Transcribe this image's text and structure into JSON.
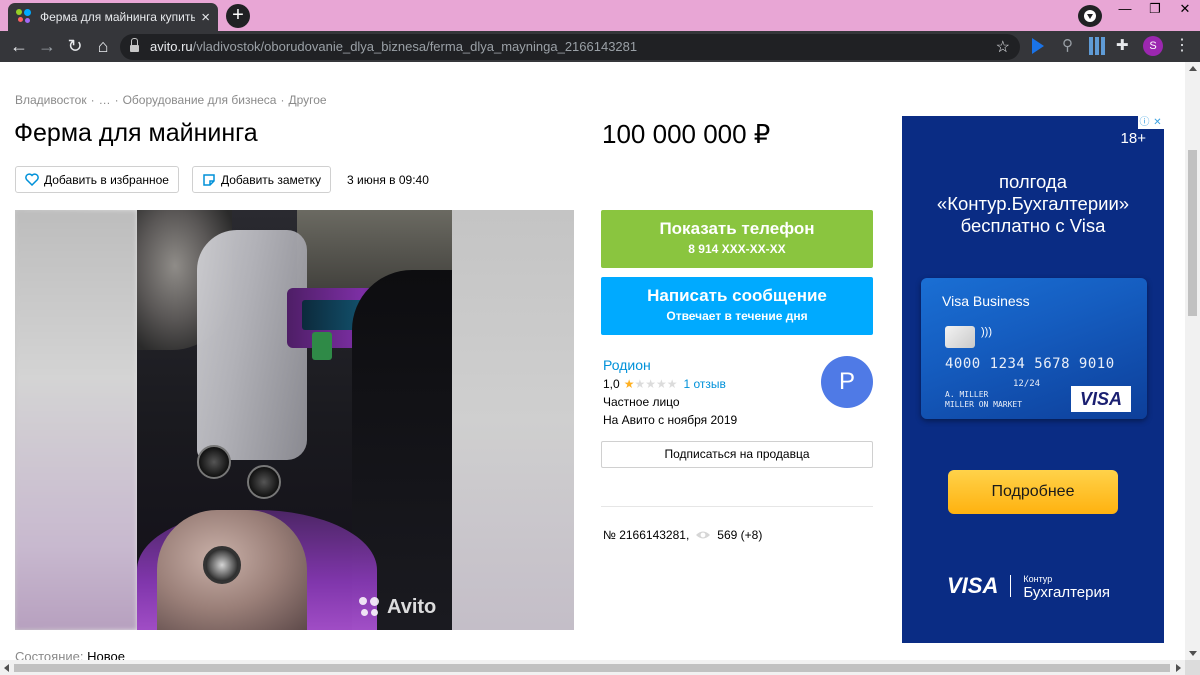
{
  "browser": {
    "tab_title": "Ферма для майнинга купить в В",
    "url_host": "avito.ru",
    "url_path": "/vladivostok/oborudovanie_dlya_biznesa/ferma_dlya_mayninga_2166143281",
    "new_tab_label": "+",
    "close_tab_label": "×",
    "profile_initial": "S",
    "window_controls": {
      "minimize": "—",
      "restore": "❐",
      "close": "✕"
    }
  },
  "breadcrumb": {
    "items": [
      "Владивосток",
      "…",
      "Оборудование для бизнеса",
      "Другое"
    ],
    "separator": "·"
  },
  "listing": {
    "title": "Ферма для майнинга",
    "price": "100 000 000 ₽",
    "favorite_label": "Добавить в избранное",
    "note_label": "Добавить заметку",
    "date": "3 июня в 09:40",
    "photo_watermark": "Avito",
    "condition_label": "Состояние:",
    "condition_value": "Новое",
    "ad_number": "№ 2166143281,",
    "views": "569 (+8)"
  },
  "contact": {
    "phone_button": "Показать телефон",
    "phone_masked": "8 914 XXX-XX-XX",
    "message_button": "Написать сообщение",
    "message_sub": "Отвечает в течение дня",
    "subscribe_button": "Подписаться на продавца"
  },
  "seller": {
    "name": "Родион",
    "rating": "1,0",
    "rating_stars": 1,
    "rating_max": 5,
    "reviews": "1 отзыв",
    "type": "Частное лицо",
    "since": "На Авито с ноября 2019",
    "avatar_letter": "Р",
    "avatar_color": "#4f7ae6"
  },
  "banner": {
    "age_badge": "18+",
    "headline": [
      "полгода",
      "«Контур.Бухгалтерии»",
      "бесплатно с Visa"
    ],
    "card_name": "Visa Business",
    "card_number": "4000 1234 5678 9010",
    "card_expiry": "12/24",
    "card_holder": "A. MILLER\nMILLER ON MARKET",
    "card_brand": "VISA",
    "cta": "Подробнее",
    "footer_visa": "VISA",
    "footer_kontur_small": "Контур",
    "footer_kontur": "Бухгалтерия",
    "adchoices": [
      "ⓘ",
      "✕"
    ]
  },
  "colors": {
    "tabstrip": "#e8a6d5",
    "toolbar": "#35363a",
    "green_button": "#8ac53f",
    "blue_button": "#00aaff",
    "link": "#0091d9",
    "banner_bg": "#0a2c84",
    "cta": "#ffb20f"
  },
  "icons": {
    "favorite": "heart-icon",
    "note": "note-icon",
    "views": "eye-icon",
    "star_rating": "star-icon"
  }
}
